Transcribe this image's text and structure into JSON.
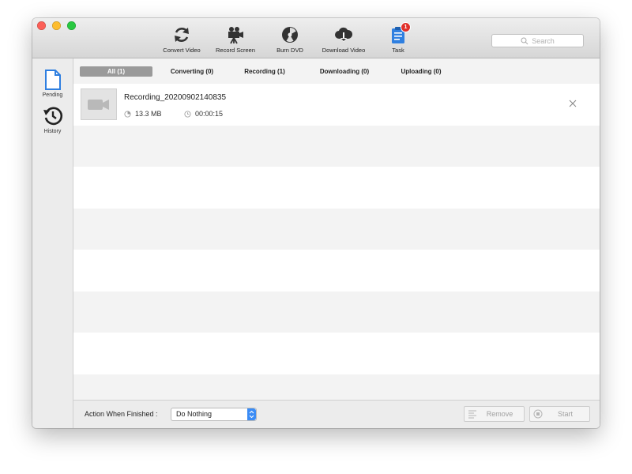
{
  "toolbar": {
    "items": [
      {
        "label": "Convert Video",
        "icon": "refresh-icon"
      },
      {
        "label": "Record Screen",
        "icon": "video-camera-icon"
      },
      {
        "label": "Burn DVD",
        "icon": "disc-icon"
      },
      {
        "label": "Download Video",
        "icon": "cloud-download-icon"
      },
      {
        "label": "Task",
        "icon": "clipboard-icon",
        "badge": "1"
      }
    ],
    "search_placeholder": "Search"
  },
  "sidebar": {
    "items": [
      {
        "label": "Pending",
        "icon": "document-icon",
        "active": true
      },
      {
        "label": "History",
        "icon": "history-icon",
        "active": false
      }
    ]
  },
  "tabs": [
    {
      "label": "All (1)",
      "active": true
    },
    {
      "label": "Converting (0)",
      "active": false
    },
    {
      "label": "Recording (1)",
      "active": false
    },
    {
      "label": "Downloading (0)",
      "active": false
    },
    {
      "label": "Uploading (0)",
      "active": false
    }
  ],
  "task": {
    "title": "Recording_20200902140835",
    "size": "13.3 MB",
    "duration": "00:00:15"
  },
  "footer": {
    "action_label": "Action When Finished :",
    "action_value": "Do Nothing",
    "remove_label": "Remove",
    "start_label": "Start"
  },
  "colors": {
    "accent": "#3b8cf5",
    "badge": "#e0302a",
    "active_tab": "#9a9a9a"
  }
}
